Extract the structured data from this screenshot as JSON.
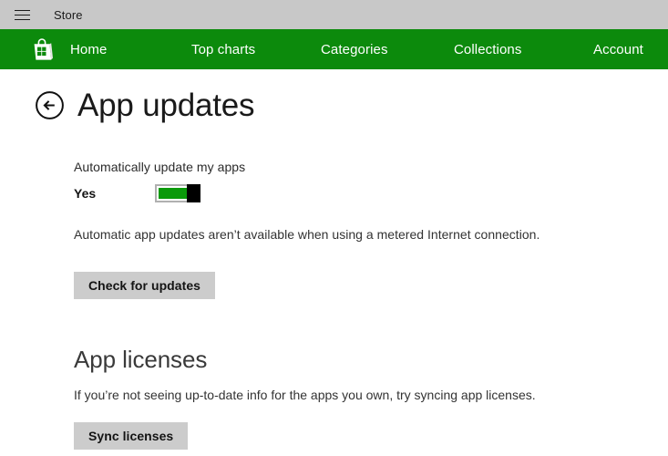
{
  "titlebar": {
    "menu_icon": "hamburger-menu-icon",
    "app_title": "Store"
  },
  "navbar": {
    "brand_icon": "store-bag-icon",
    "items": [
      {
        "label": "Home"
      },
      {
        "label": "Top charts"
      },
      {
        "label": "Categories"
      },
      {
        "label": "Collections"
      },
      {
        "label": "Account"
      }
    ]
  },
  "page": {
    "back_icon": "back-arrow-circle-icon",
    "title": "App updates",
    "auto_update": {
      "label": "Automatically update my apps",
      "toggle_state": "Yes",
      "toggle_on": true,
      "note": "Automatic app updates aren’t available when using a metered Internet connection.",
      "check_button": "Check for updates"
    },
    "app_licenses": {
      "heading": "App licenses",
      "description": "If you’re not seeing up-to-date info for the apps you own, try syncing app licenses.",
      "sync_button": "Sync licenses"
    }
  },
  "colors": {
    "titlebar_bg": "#c8c8c8",
    "nav_green": "#0c8a0c",
    "toggle_green": "#0a9a0a",
    "button_gray": "#cccccc",
    "text_dark": "#1a1a1a"
  }
}
